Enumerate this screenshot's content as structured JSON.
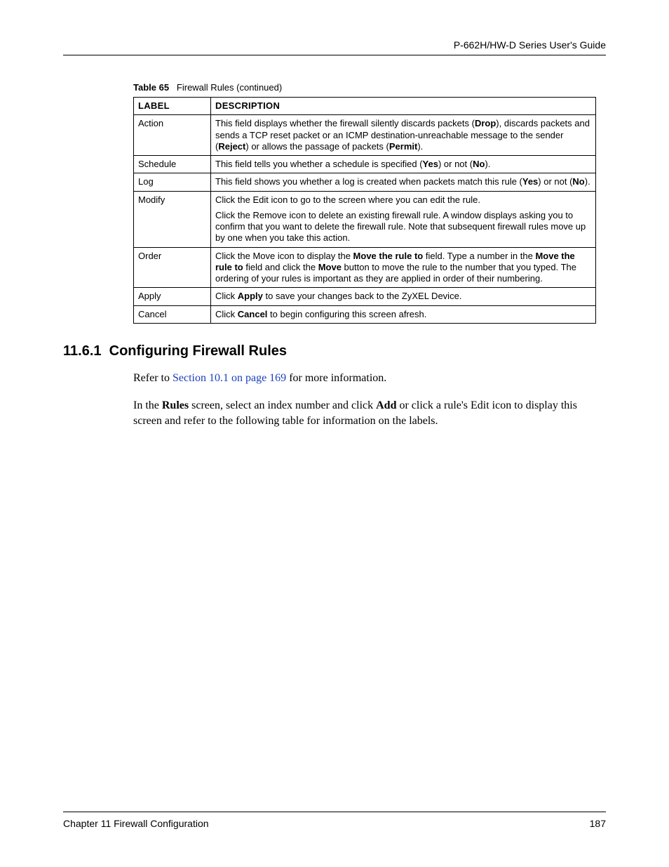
{
  "header": {
    "guide_title": "P-662H/HW-D Series User's Guide"
  },
  "table": {
    "caption_label": "Table 65",
    "caption_title": "Firewall Rules (continued)",
    "head": {
      "label": "LABEL",
      "description": "DESCRIPTION"
    },
    "rows": [
      {
        "label": "Action",
        "desc": [
          {
            "segs": [
              {
                "t": "This field displays whether the firewall silently discards packets ("
              },
              {
                "t": "Drop",
                "b": true
              },
              {
                "t": "), discards packets and sends a TCP reset packet or an ICMP destination-unreachable message to the sender ("
              },
              {
                "t": "Reject",
                "b": true
              },
              {
                "t": ") or allows the passage of packets ("
              },
              {
                "t": "Permit",
                "b": true
              },
              {
                "t": ")."
              }
            ]
          }
        ]
      },
      {
        "label": "Schedule",
        "desc": [
          {
            "segs": [
              {
                "t": "This field tells you whether a schedule is specified ("
              },
              {
                "t": "Yes",
                "b": true
              },
              {
                "t": ") or not ("
              },
              {
                "t": "No",
                "b": true
              },
              {
                "t": ")."
              }
            ]
          }
        ]
      },
      {
        "label": "Log",
        "desc": [
          {
            "segs": [
              {
                "t": "This field shows you whether a log is created when packets match this rule ("
              },
              {
                "t": "Yes",
                "b": true
              },
              {
                "t": ") or not ("
              },
              {
                "t": "No",
                "b": true
              },
              {
                "t": ")."
              }
            ]
          }
        ]
      },
      {
        "label": "Modify",
        "desc": [
          {
            "segs": [
              {
                "t": "Click the Edit icon to go to the screen where you can edit the rule."
              }
            ]
          },
          {
            "segs": [
              {
                "t": "Click the Remove icon to delete an existing firewall rule. A window displays asking you to confirm that you want to delete the firewall rule. Note that subsequent firewall rules move up by one when you take this action."
              }
            ]
          }
        ]
      },
      {
        "label": "Order",
        "desc": [
          {
            "segs": [
              {
                "t": "Click the Move icon to display the "
              },
              {
                "t": "Move the rule to",
                "b": true
              },
              {
                "t": " field. Type a number in the "
              },
              {
                "t": "Move the rule to",
                "b": true
              },
              {
                "t": " field and click the "
              },
              {
                "t": "Move",
                "b": true
              },
              {
                "t": " button to move the rule to the number that you typed. The ordering of your rules is important as they are applied in order of their numbering."
              }
            ]
          }
        ]
      },
      {
        "label": "Apply",
        "desc": [
          {
            "segs": [
              {
                "t": "Click "
              },
              {
                "t": "Apply",
                "b": true
              },
              {
                "t": " to save your changes back to the ZyXEL Device."
              }
            ]
          }
        ]
      },
      {
        "label": "Cancel",
        "desc": [
          {
            "segs": [
              {
                "t": "Click "
              },
              {
                "t": "Cancel",
                "b": true
              },
              {
                "t": " to begin configuring this screen afresh."
              }
            ]
          }
        ]
      }
    ]
  },
  "section": {
    "number": "11.6.1",
    "title": "Configuring Firewall Rules"
  },
  "paragraphs": {
    "p1_pre": "Refer to ",
    "p1_link": "Section 10.1 on page 169",
    "p1_post": " for more information.",
    "p2_pre": "In the ",
    "p2_bold1": "Rules",
    "p2_mid": " screen, select an index number and click ",
    "p2_bold2": "Add",
    "p2_post": " or click a rule's Edit icon to display this screen and refer to the following table for information on the labels."
  },
  "footer": {
    "chapter": "Chapter 11 Firewall Configuration",
    "page": "187"
  }
}
